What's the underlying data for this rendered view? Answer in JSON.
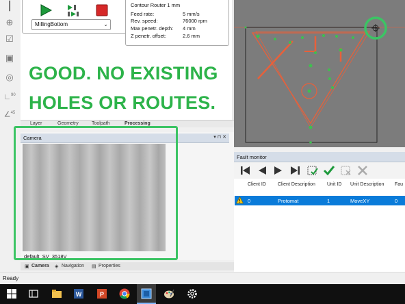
{
  "left_toolbar": {
    "tools": [
      "line-tool-icon",
      "crosshair-tool-icon",
      "checklist-tool-icon",
      "camera-tool-icon",
      "gauge-tool-icon",
      "angle-90-icon",
      "angle-45-icon"
    ],
    "labels": {
      "angle90": "90",
      "angle45": "45"
    }
  },
  "job": {
    "selected": "MillingBottom",
    "buttons": [
      "start-button",
      "step-button",
      "stop-button"
    ]
  },
  "tool_params": {
    "title": "Contour Router 1 mm",
    "rows": [
      {
        "label": "Feed rate:",
        "value": "5 mm/s"
      },
      {
        "label": "Rev. speed:",
        "value": "76000 rpm"
      },
      {
        "label": "Max penetr. depth:",
        "value": "4 mm"
      },
      {
        "label": "Z penetr. offset:",
        "value": "2.6 mm"
      }
    ]
  },
  "headline": {
    "line1": "GOOD.  NO EXISTING",
    "line2": "HOLES OR ROUTES."
  },
  "upper_tabs": [
    "Layer",
    "Geometry",
    "Toolpath",
    "Processing"
  ],
  "camera": {
    "title": "Camera",
    "filename": "default_SV_3518V",
    "pin": "▾ ⊓ ✕"
  },
  "bottom_tabs": [
    "Camera",
    "Navigation",
    "Properties"
  ],
  "fault_monitor": {
    "title": "Fault monitor",
    "columns": [
      "Client ID",
      "Client Description",
      "Unit ID",
      "Unit Description",
      "Fau"
    ],
    "rows": [
      {
        "client_id": "0",
        "client_desc": "Protomat",
        "unit_id": "1",
        "unit_desc": "MoveXY",
        "fault": "0"
      }
    ]
  },
  "status": "Ready",
  "taskbar_icons": [
    "windows-start-icon",
    "task-view-icon",
    "file-explorer-icon",
    "word-icon",
    "powerpoint-icon",
    "chrome-icon",
    "circuitpro-icon",
    "paint-icon",
    "settings-icon"
  ],
  "colors": {
    "accent_green": "#2db34a",
    "highlight_green": "#3cc464",
    "selection_blue": "#0a7bd9",
    "route_orange": "#e8603a"
  }
}
